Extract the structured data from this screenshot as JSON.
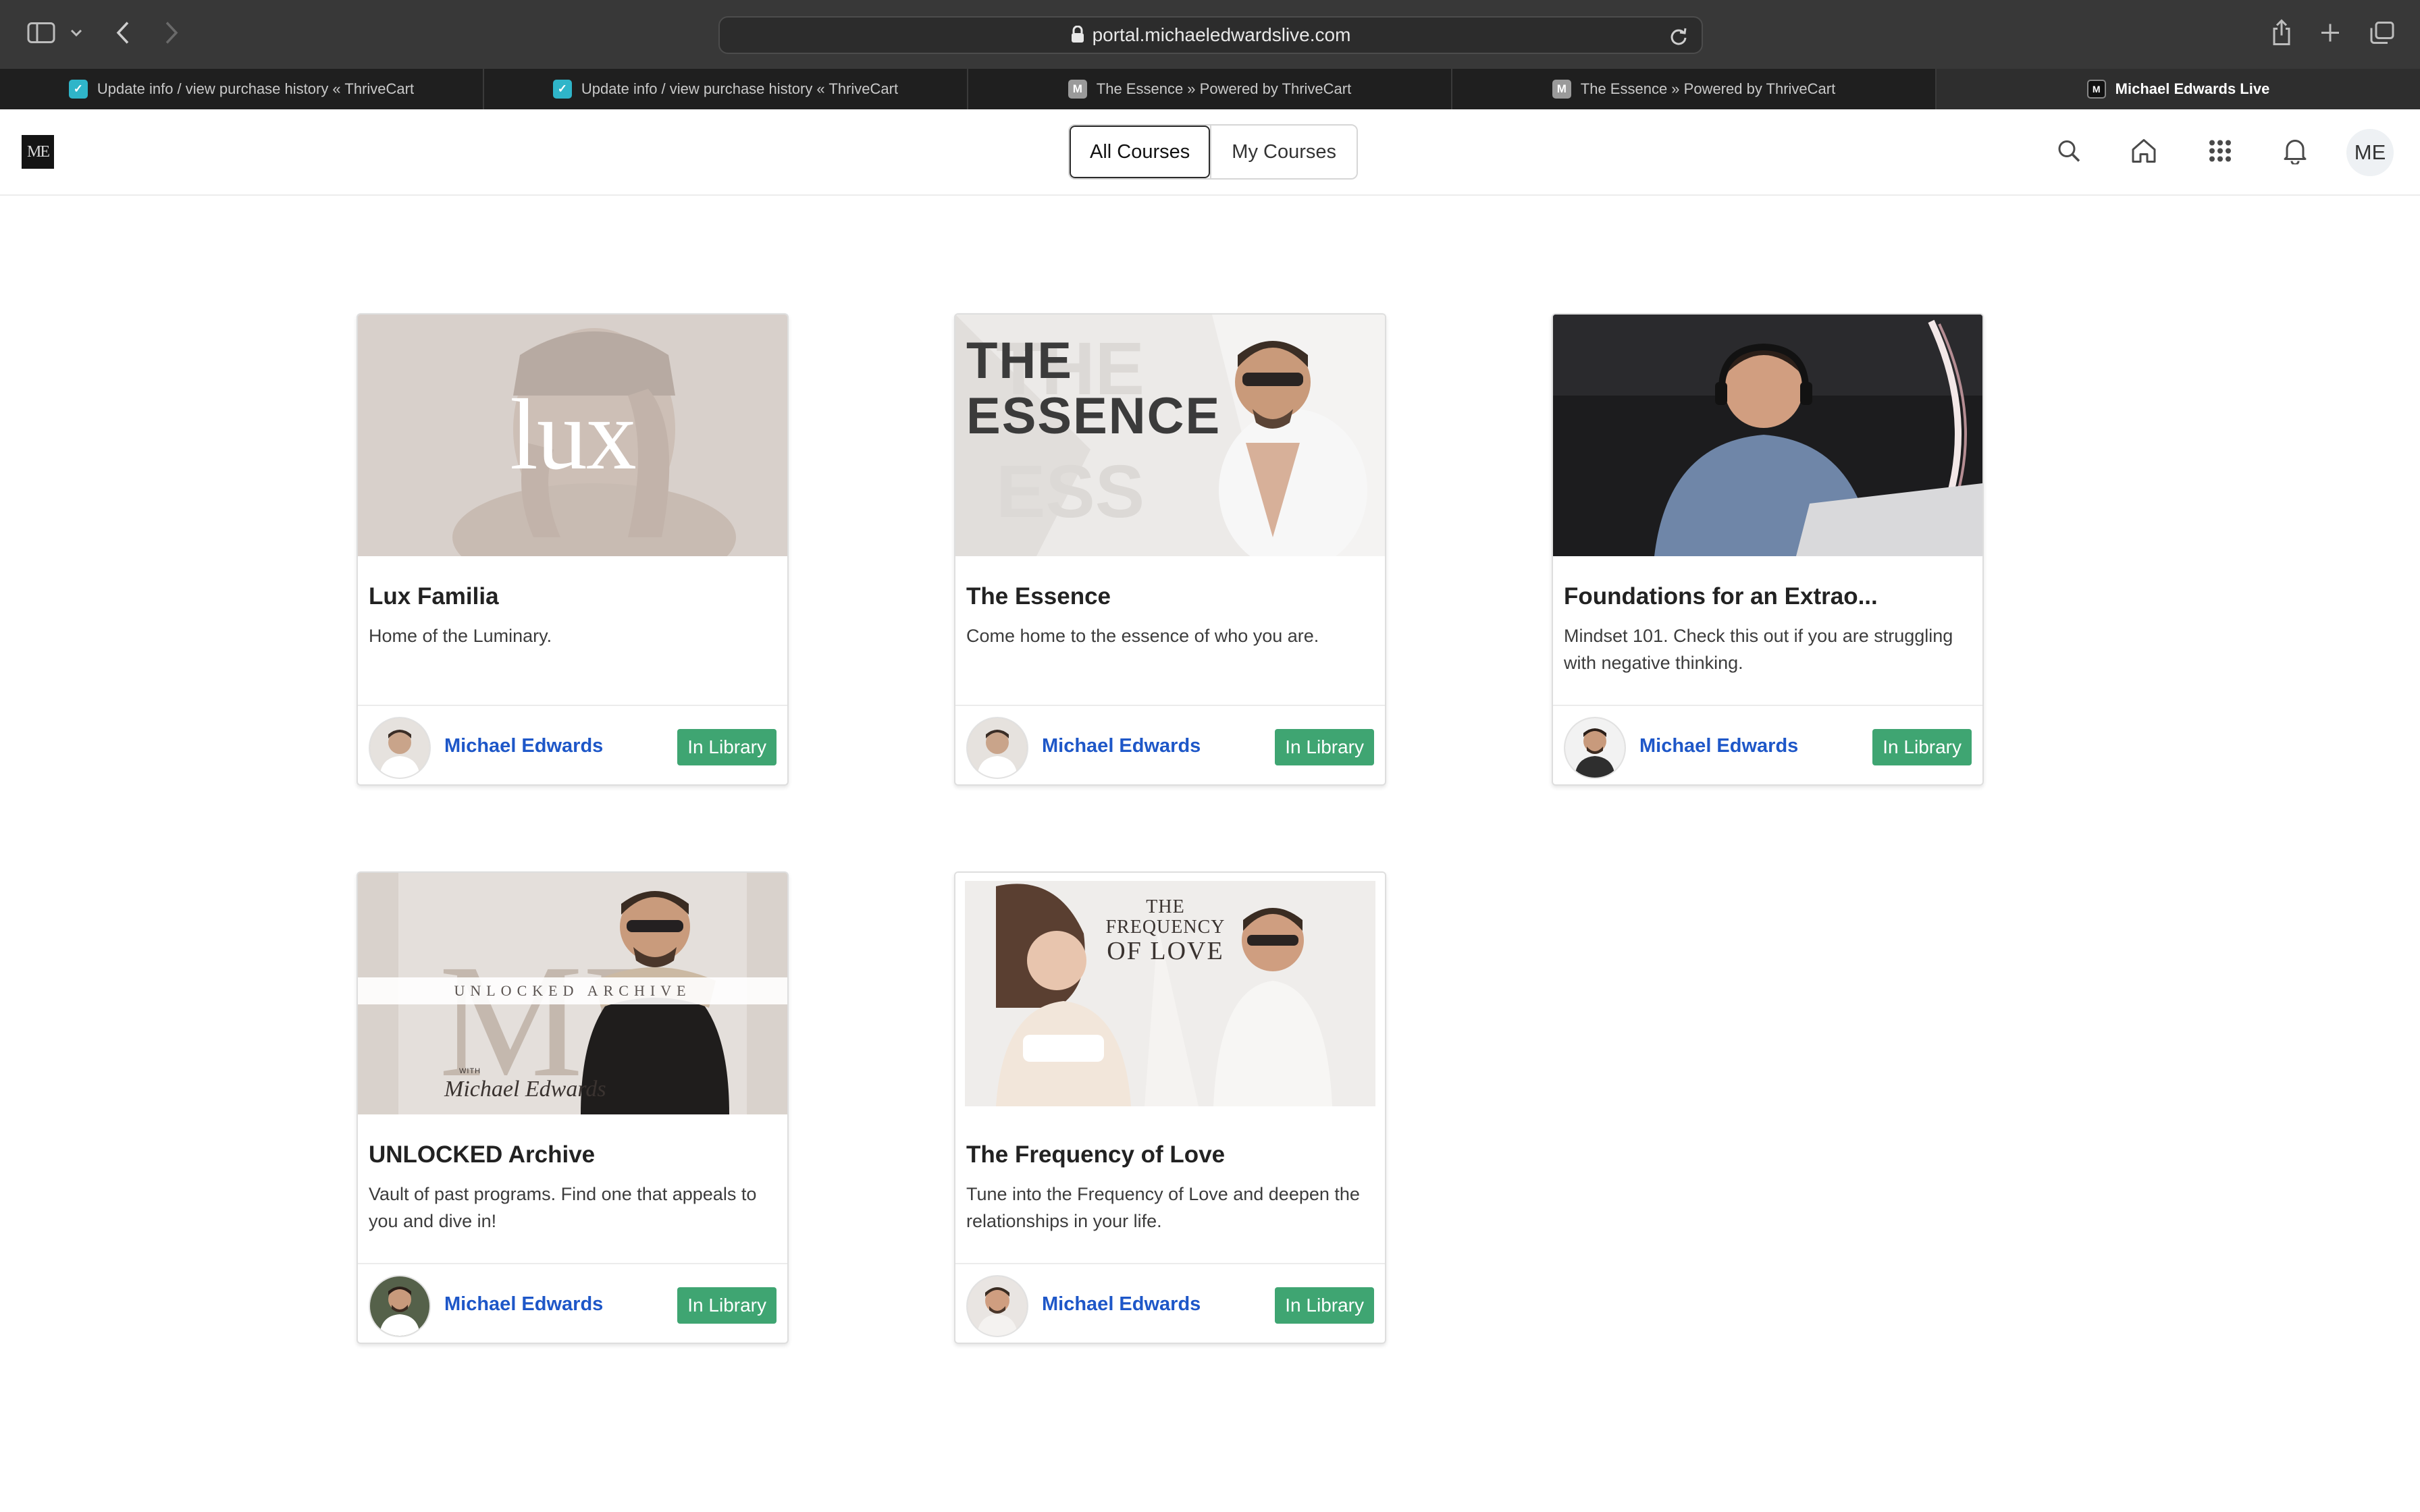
{
  "browser": {
    "url": "portal.michaeledwardslive.com",
    "tabs": [
      {
        "label": "Update info / view purchase history « ThriveCart",
        "icon": "thrivecart-icon",
        "active": false
      },
      {
        "label": "Update info / view purchase history « ThriveCart",
        "icon": "thrivecart-icon",
        "active": false
      },
      {
        "label": "The Essence » Powered by ThriveCart",
        "icon": "m-icon",
        "favicon_letter": "M",
        "active": false
      },
      {
        "label": "The Essence » Powered by ThriveCart",
        "icon": "m-icon",
        "favicon_letter": "M",
        "active": false
      },
      {
        "label": "Michael Edwards Live",
        "icon": "me-logo-icon",
        "active": true
      }
    ]
  },
  "header": {
    "logo_text": "ME",
    "nav": {
      "all_courses": "All Courses",
      "my_courses": "My Courses"
    },
    "icons": [
      "search-icon",
      "home-icon",
      "apps-grid-icon",
      "bell-icon"
    ],
    "user_initials": "ME"
  },
  "courses": [
    {
      "title": "Lux Familia",
      "description": "Home of the Luminary.",
      "author": "Michael Edwards",
      "badge": "In Library",
      "thumb_text": "lux"
    },
    {
      "title": "The Essence",
      "description": "Come home to the essence of who you are.",
      "author": "Michael Edwards",
      "badge": "In Library",
      "thumb_text_1": "THE",
      "thumb_text_2": "ESSENCE"
    },
    {
      "title": "Foundations for an Extrao...",
      "description": "Mindset 101. Check this out if you are struggling with negative thinking.",
      "author": "Michael Edwards",
      "badge": "In Library"
    },
    {
      "title": "UNLOCKED Archive",
      "description": "Vault of past programs. Find one that appeals to you and dive in!",
      "author": "Michael Edwards",
      "badge": "In Library",
      "thumb_text": "UNLOCKED ARCHIVE",
      "thumb_with": "WITH",
      "thumb_signature": "Michael Edwards"
    },
    {
      "title": "The Frequency of Love",
      "description": "Tune into the Frequency of Love and deepen the relationships in your life.",
      "author": "Michael Edwards",
      "badge": "In Library",
      "thumb_text_1": "THE FREQUENCY",
      "thumb_text_2": "OF LOVE"
    }
  ],
  "colors": {
    "badge": "#3fa572",
    "author_link": "#1e57c8",
    "chrome": "#383838"
  }
}
